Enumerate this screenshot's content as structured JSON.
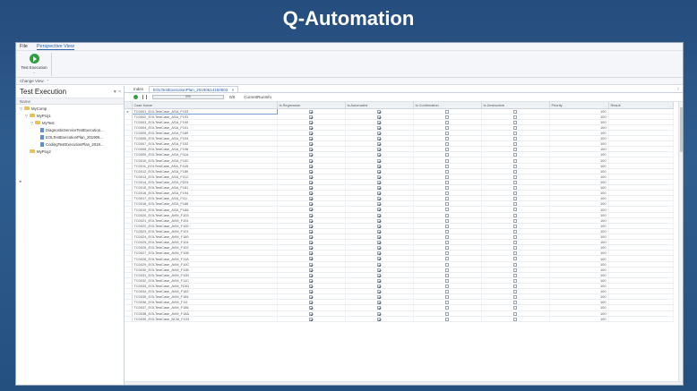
{
  "slide": {
    "title": "Q-Automation"
  },
  "menu": {
    "items": [
      "File",
      "Perspective View"
    ]
  },
  "ribbon": {
    "run_label": "Test Execution",
    "group_label": "Change View"
  },
  "left_pane": {
    "title": "Test Execution",
    "pin_glyph": "▼ ×",
    "column_header": "Name",
    "tree": [
      {
        "label": "MyComp",
        "level": 0,
        "type": "folder",
        "exp": "▽"
      },
      {
        "label": "MyProj1",
        "level": 1,
        "type": "folder",
        "exp": "▽"
      },
      {
        "label": "MyTest",
        "level": 2,
        "type": "folder",
        "exp": "▽"
      },
      {
        "label": "DiagnosticServiceTestExecution...",
        "level": 3,
        "type": "file",
        "exp": ""
      },
      {
        "label": "EOLTestExecutionPlan_201906...",
        "level": 3,
        "type": "file",
        "exp": ""
      },
      {
        "label": "CodingTestExecutionPlan_2019...",
        "level": 3,
        "type": "file",
        "exp": ""
      },
      {
        "label": "MyProj2",
        "level": 1,
        "type": "folder",
        "exp": ""
      }
    ]
  },
  "tabs": {
    "items": [
      "Index",
      "EOLTestExecutionPlan_20190614150603"
    ],
    "close_glyph": "×",
    "menu_glyph": "▿"
  },
  "toolbar": {
    "progress_text": "0%",
    "count_text": "0/0",
    "info_text": "CurrentRunInfo"
  },
  "grid": {
    "columns": [
      "Case Name",
      "Is Regression",
      "Is Automated",
      "Is Confirmation",
      "Is Destructive",
      "Priority",
      "Result"
    ],
    "rows": [
      [
        "TC0001_EOLTestCase_ASA_F103",
        true,
        true,
        false,
        false,
        "100"
      ],
      [
        "TC0002_EOLTestCase_ASA_F191",
        true,
        true,
        false,
        false,
        "100"
      ],
      [
        "TC0003_EOLTestCase_ASA_F190",
        true,
        true,
        false,
        false,
        "100"
      ],
      [
        "TC0004_EOLTestCase_ASA_F101",
        true,
        true,
        false,
        false,
        "100"
      ],
      [
        "TC0005_EOLTestCase_ASA_F189",
        true,
        true,
        false,
        false,
        "100"
      ],
      [
        "TC0006_EOLTestCase_ASA_F104",
        true,
        true,
        false,
        false,
        "100"
      ],
      [
        "TC0007_EOLTestCase_ASA_F102",
        true,
        true,
        false,
        false,
        "100"
      ],
      [
        "TC0008_EOLTestCase_ASA_F108",
        true,
        true,
        false,
        false,
        "100"
      ],
      [
        "TC0009_EOLTestCase_ASA_F11A",
        true,
        true,
        false,
        false,
        "100"
      ],
      [
        "TC0010_EOLTestCase_ASA_F10C",
        true,
        true,
        false,
        false,
        "100"
      ],
      [
        "TC0011_EOLTestCase_ASA_F11B",
        true,
        true,
        false,
        false,
        "100"
      ],
      [
        "TC0012_EOLTestCase_ASA_F189",
        true,
        true,
        false,
        false,
        "100"
      ],
      [
        "TC0013_EOLTestCase_ASA_F11C",
        true,
        true,
        false,
        false,
        "100"
      ],
      [
        "TC0014_EOLTestCase_ASA_FD01",
        true,
        true,
        false,
        false,
        "100"
      ],
      [
        "TC0015_EOLTestCase_ASA_F181",
        true,
        true,
        false,
        false,
        "100"
      ],
      [
        "TC0016_EOLTestCase_ASA_F194",
        true,
        true,
        false,
        false,
        "100"
      ],
      [
        "TC0017_EOLTestCase_ASA_F11I",
        true,
        true,
        false,
        false,
        "100"
      ],
      [
        "TC0018_EOLTestCase_ASA_F186",
        true,
        true,
        false,
        false,
        "100"
      ],
      [
        "TC0019_EOLTestCase_ASA_F18A",
        true,
        true,
        false,
        false,
        "100"
      ],
      [
        "TC0020_EOLTestCase_AVM_F103",
        true,
        true,
        false,
        false,
        "100"
      ],
      [
        "TC0021_EOLTestCase_AVM_F191",
        true,
        true,
        false,
        false,
        "100"
      ],
      [
        "TC0022_EOLTestCase_AVM_F190",
        true,
        true,
        false,
        false,
        "100"
      ],
      [
        "TC0023_EOLTestCase_AVM_F101",
        true,
        true,
        false,
        false,
        "100"
      ],
      [
        "TC0024_EOLTestCase_AVM_F189",
        true,
        true,
        false,
        false,
        "100"
      ],
      [
        "TC0025_EOLTestCase_AVM_F104",
        true,
        true,
        false,
        false,
        "100"
      ],
      [
        "TC0026_EOLTestCase_AVM_F102",
        true,
        true,
        false,
        false,
        "100"
      ],
      [
        "TC0027_EOLTestCase_AVM_F108",
        true,
        true,
        false,
        false,
        "100"
      ],
      [
        "TC0028_EOLTestCase_AVM_F11A",
        true,
        true,
        false,
        false,
        "100"
      ],
      [
        "TC0029_EOLTestCase_AVM_F10C",
        true,
        true,
        false,
        false,
        "100"
      ],
      [
        "TC0030_EOLTestCase_AVM_F11B",
        true,
        true,
        false,
        false,
        "100"
      ],
      [
        "TC0031_EOLTestCase_AVM_F10D",
        true,
        true,
        false,
        false,
        "100"
      ],
      [
        "TC0032_EOLTestCase_AVM_F11C",
        true,
        true,
        false,
        false,
        "100"
      ],
      [
        "TC0033_EOLTestCase_AVM_FD01",
        true,
        true,
        false,
        false,
        "100"
      ],
      [
        "TC0034_EOLTestCase_AVM_F182",
        true,
        true,
        false,
        false,
        "100"
      ],
      [
        "TC0035_EOLTestCase_AVM_F184",
        true,
        true,
        false,
        false,
        "100"
      ],
      [
        "TC0036_EOLTestCase_AVM_F11I",
        true,
        true,
        false,
        false,
        "100"
      ],
      [
        "TC0037_EOLTestCase_AVM_F186",
        true,
        true,
        false,
        false,
        "100"
      ],
      [
        "TC0038_EOLTestCase_AVM_F18A",
        true,
        true,
        false,
        false,
        "100"
      ],
      [
        "TC0039_EOLTestCase_BCM_F103",
        true,
        true,
        false,
        false,
        "100"
      ]
    ]
  }
}
